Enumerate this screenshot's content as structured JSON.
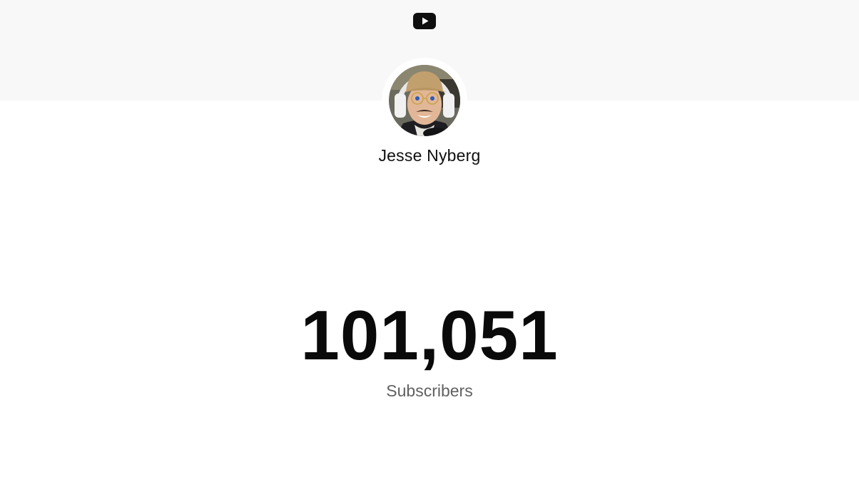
{
  "header": {
    "logo_icon": "youtube-play-icon",
    "logo_color": "#0f0f0f"
  },
  "channel": {
    "name": "Jesse Nyberg",
    "avatar_icon": "channel-avatar-photo"
  },
  "stats": {
    "subscriber_count": "101,051",
    "subscriber_label": "Subscribers"
  },
  "colors": {
    "banner": "#f8f8f8",
    "background": "#ffffff",
    "count_text": "#0a0a0a",
    "label_text": "#606060"
  }
}
